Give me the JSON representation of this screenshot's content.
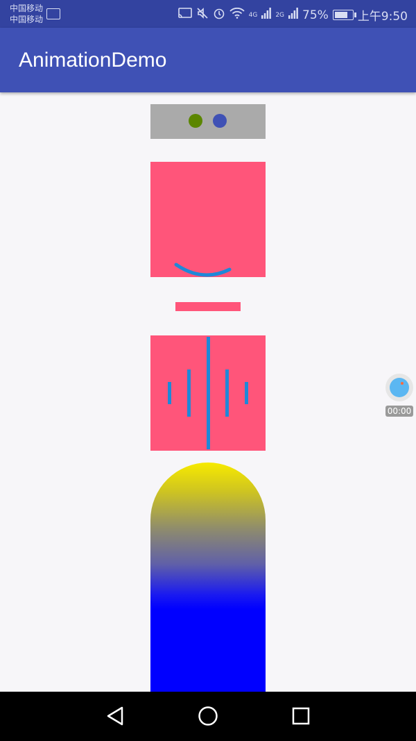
{
  "status_bar": {
    "carrier_1": "中国移动",
    "carrier_2": "中国移动",
    "network_1": "4G",
    "network_2": "2G",
    "battery_percent": "75%",
    "time": "上午9:50"
  },
  "app_bar": {
    "title": "AnimationDemo"
  },
  "colors": {
    "primary": "#3f51b5",
    "primary_dark": "#3343a0",
    "pink": "#ff557a",
    "accent_blue": "#1e88d8",
    "dot_green": "#5b8600",
    "gradient_top": "#f7ea00",
    "gradient_bottom": "#0000ff"
  },
  "recorder": {
    "time": "00:00"
  },
  "nav": {
    "back_icon": "back-triangle-icon",
    "home_icon": "home-circle-icon",
    "recents_icon": "recents-square-icon"
  }
}
